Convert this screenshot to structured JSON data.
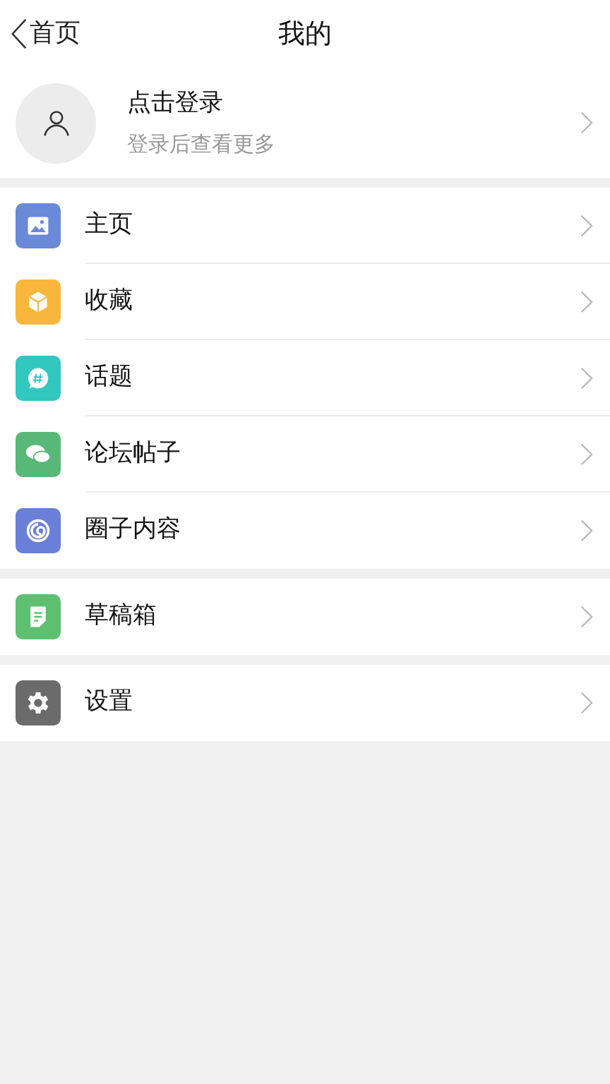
{
  "header": {
    "back_label": "首页",
    "title": "我的"
  },
  "profile": {
    "name": "点击登录",
    "subtitle": "登录后查看更多"
  },
  "groups": [
    {
      "items": [
        {
          "kind": "image",
          "label": "主页",
          "color": "#6a8ad8"
        },
        {
          "kind": "cube",
          "label": "收藏",
          "color": "#f8b73c"
        },
        {
          "kind": "hashtag",
          "label": "话题",
          "color": "#32c8c0"
        },
        {
          "kind": "chat",
          "label": "论坛帖子",
          "color": "#58b878"
        },
        {
          "kind": "spiral",
          "label": "圈子内容",
          "color": "#6a7fd8"
        }
      ]
    },
    {
      "items": [
        {
          "kind": "note",
          "label": "草稿箱",
          "color": "#5cc070"
        }
      ]
    },
    {
      "items": [
        {
          "kind": "gear",
          "label": "设置",
          "color": "#6b6b6b"
        }
      ]
    }
  ]
}
